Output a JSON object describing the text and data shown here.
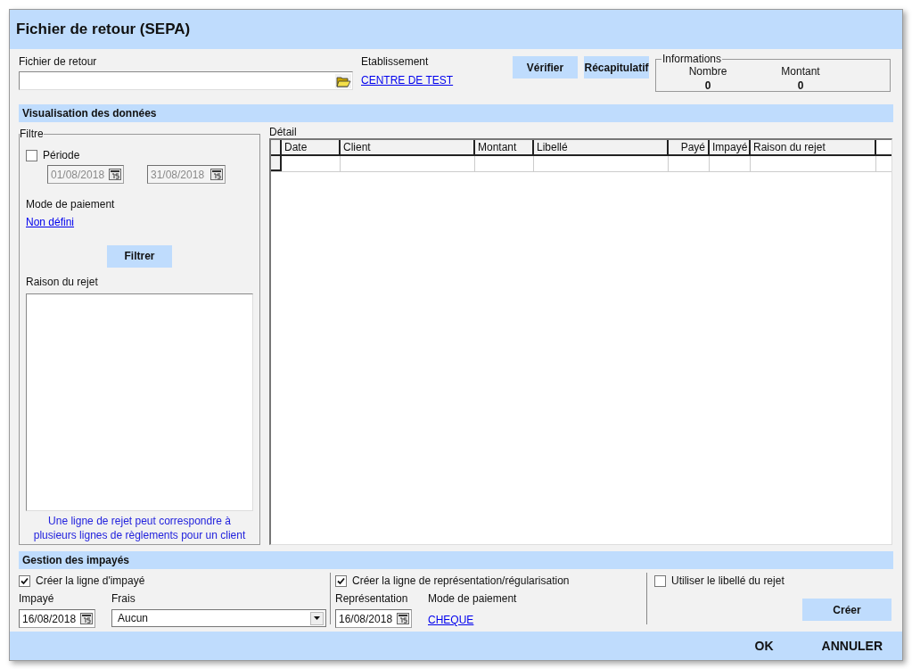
{
  "window": {
    "title": "Fichier de retour (SEPA)"
  },
  "file": {
    "label": "Fichier de retour"
  },
  "establishment": {
    "label": "Etablissement",
    "link": "CENTRE DE TEST"
  },
  "top_buttons": [
    "Vérifier",
    "Récapitulatif"
  ],
  "informations": {
    "title": "Informations",
    "columns": [
      {
        "label": "Nombre",
        "value": "0"
      },
      {
        "label": "Montant",
        "value": "0"
      }
    ]
  },
  "data_section": {
    "title": "Visualisation des données"
  },
  "filter": {
    "title": "Filtre",
    "period": {
      "label": "Période",
      "checked": false,
      "disabled": true,
      "from": "01/08/2018",
      "to": "31/08/2018"
    },
    "payment_mode": {
      "label": "Mode de paiement",
      "link": "Non défini"
    },
    "button": "Filtrer",
    "reject_reason": {
      "label": "Raison du rejet"
    },
    "note": "Une ligne de rejet peut correspondre à plusieurs lignes de règlements pour un client"
  },
  "detail": {
    "title": "Détail",
    "columns": [
      "Date",
      "Client",
      "Montant",
      "Libellé",
      "Payé",
      "Impayé",
      "Raison du rejet"
    ]
  },
  "unpaid_section": {
    "title": "Gestion des impayés",
    "create_unpaid": {
      "label": "Créer la ligne d'impayé",
      "checked": true
    },
    "unpaid_date": {
      "label": "Impayé",
      "value": "16/08/2018"
    },
    "fees": {
      "label": "Frais",
      "value": "Aucun"
    },
    "create_representation": {
      "label": "Créer la ligne de représentation/régularisation",
      "checked": true
    },
    "representation_date": {
      "label": "Représentation",
      "value": "16/08/2018"
    },
    "payment_mode": {
      "label": "Mode de paiement",
      "link": "CHEQUE"
    },
    "use_reject_label": {
      "label": "Utiliser le libellé du rejet",
      "checked": false
    },
    "create_button": "Créer"
  },
  "footer_buttons": [
    "OK",
    "ANNULER"
  ]
}
